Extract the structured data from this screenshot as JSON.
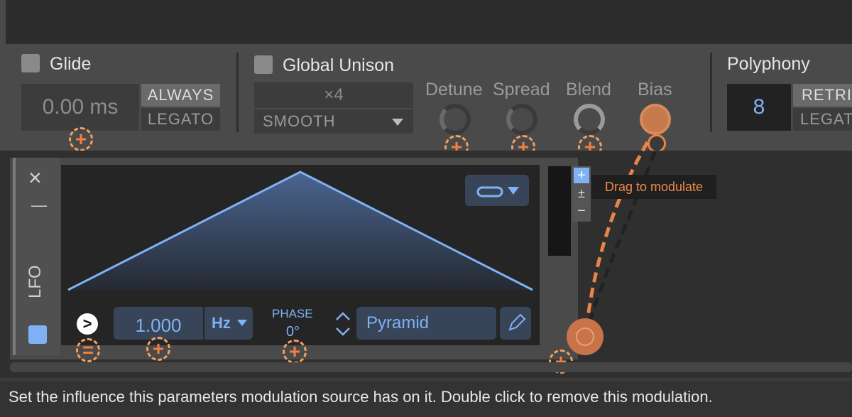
{
  "glide": {
    "label": "Glide",
    "time_value": "0.00 ms",
    "always_label": "ALWAYS",
    "legato_label": "LEGATO"
  },
  "unison": {
    "label": "Global Unison",
    "voices": "×4",
    "mode": "SMOOTH"
  },
  "knobs": [
    {
      "label": "Detune"
    },
    {
      "label": "Spread"
    },
    {
      "label": "Blend"
    },
    {
      "label": "Bias"
    }
  ],
  "polyphony": {
    "label": "Polyphony",
    "value": "8",
    "retrig_label": "RETRIG",
    "legato_label": "LEGAT"
  },
  "lfo": {
    "vertical_label": "LFO",
    "close_label": "×",
    "minimize_label": "—",
    "rate_value": "1.000",
    "rate_unit": "Hz",
    "phase_label": "PHASE",
    "phase_value": "0°",
    "shape_name": "Pyramid",
    "play_label": ">",
    "scale_plus": "+",
    "scale_plusminus": "±",
    "scale_minus": "−"
  },
  "modulation": {
    "target_symbol": "+",
    "tooltip": "Drag to modulate",
    "bypass_symbol": "="
  },
  "status": {
    "text": "Set the influence this parameters modulation source has on it. Double click to remove this modulation."
  },
  "colors": {
    "accent_blue": "#7fb2f5",
    "mod_orange": "#f08040"
  }
}
